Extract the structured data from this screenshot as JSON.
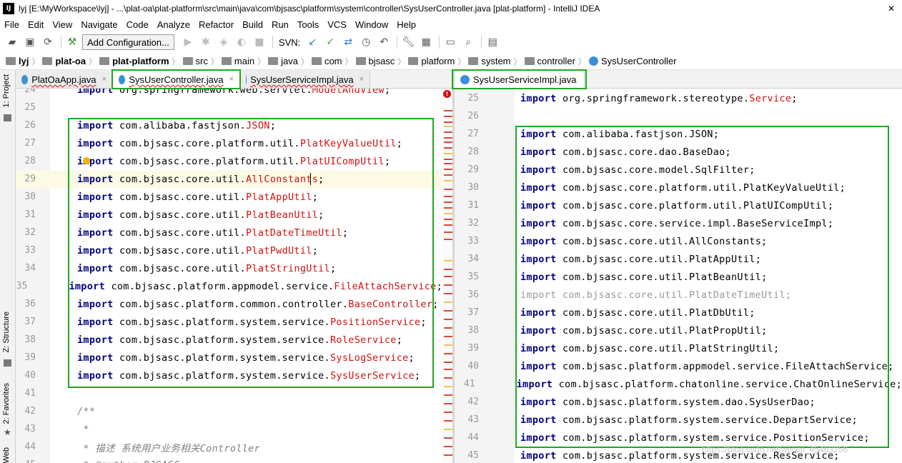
{
  "window": {
    "title": "lyj [E:\\MyWorkspace\\lyj] - ...\\plat-oa\\plat-platform\\src\\main\\java\\com\\bjsasc\\platform\\system\\controller\\SysUserController.java [plat-platform] - IntelliJ IDEA",
    "app_icon": "IJ",
    "close": "✕"
  },
  "menu": [
    "File",
    "Edit",
    "View",
    "Navigate",
    "Code",
    "Analyze",
    "Refactor",
    "Build",
    "Run",
    "Tools",
    "VCS",
    "Window",
    "Help"
  ],
  "toolbar": {
    "add_configuration": "Add Configuration...",
    "svn_label": "SVN:"
  },
  "breadcrumb": [
    "lyj",
    "plat-oa",
    "plat-platform",
    "src",
    "main",
    "java",
    "com",
    "bjsasc",
    "platform",
    "system",
    "controller",
    "SysUserController"
  ],
  "left_tabs": {
    "project": "1: Project",
    "structure": "Z: Structure",
    "favorites": "2: Favorites",
    "web": "Web"
  },
  "left_editor": {
    "tabs": [
      {
        "label": "PlatOaApp.java",
        "close": "×"
      },
      {
        "label": "SysUserController.java",
        "close": "×"
      },
      {
        "label": "SysUserServiceImpl.java",
        "close": "×"
      }
    ],
    "lines": [
      {
        "num": "24",
        "parts": [
          [
            "kw",
            "import"
          ],
          [
            "pk",
            " org.springframework.web.servlet."
          ],
          [
            "red",
            "ModelAndView"
          ],
          [
            "pk",
            ";"
          ]
        ]
      },
      {
        "num": "25",
        "parts": []
      },
      {
        "num": "26",
        "parts": [
          [
            "kw",
            "import"
          ],
          [
            "pk",
            " com.alibaba.fastjson."
          ],
          [
            "red",
            "JSON"
          ],
          [
            "pk",
            ";"
          ]
        ]
      },
      {
        "num": "27",
        "parts": [
          [
            "kw",
            "import"
          ],
          [
            "pk",
            " com.bjsasc.core.platform.util."
          ],
          [
            "red",
            "PlatKeyValueUtil"
          ],
          [
            "pk",
            ";"
          ]
        ]
      },
      {
        "num": "28",
        "parts": [
          [
            "kw",
            "import"
          ],
          [
            "pk",
            " com.bjsasc.core.platform.util."
          ],
          [
            "red",
            "PlatUICompUtil"
          ],
          [
            "pk",
            ";"
          ]
        ]
      },
      {
        "num": "29",
        "parts": [
          [
            "kw",
            "import"
          ],
          [
            "pk",
            " com.bjsasc.core.util."
          ],
          [
            "red",
            "AllConstants"
          ],
          [
            "pk",
            ";"
          ]
        ]
      },
      {
        "num": "30",
        "parts": [
          [
            "kw",
            "import"
          ],
          [
            "pk",
            " com.bjsasc.core.util."
          ],
          [
            "red",
            "PlatAppUtil"
          ],
          [
            "pk",
            ";"
          ]
        ]
      },
      {
        "num": "31",
        "parts": [
          [
            "kw",
            "import"
          ],
          [
            "pk",
            " com.bjsasc.core.util."
          ],
          [
            "red",
            "PlatBeanUtil"
          ],
          [
            "pk",
            ";"
          ]
        ]
      },
      {
        "num": "32",
        "parts": [
          [
            "kw",
            "import"
          ],
          [
            "pk",
            " com.bjsasc.core.util."
          ],
          [
            "red",
            "PlatDateTimeUtil"
          ],
          [
            "pk",
            ";"
          ]
        ]
      },
      {
        "num": "33",
        "parts": [
          [
            "kw",
            "import"
          ],
          [
            "pk",
            " com.bjsasc.core.util."
          ],
          [
            "red",
            "PlatPwdUtil"
          ],
          [
            "pk",
            ";"
          ]
        ]
      },
      {
        "num": "34",
        "parts": [
          [
            "kw",
            "import"
          ],
          [
            "pk",
            " com.bjsasc.core.util."
          ],
          [
            "red",
            "PlatStringUtil"
          ],
          [
            "pk",
            ";"
          ]
        ]
      },
      {
        "num": "35",
        "parts": [
          [
            "kw",
            "import"
          ],
          [
            "pk",
            " com.bjsasc.platform.appmodel.service."
          ],
          [
            "red",
            "FileAttachService"
          ],
          [
            "pk",
            ";"
          ]
        ]
      },
      {
        "num": "36",
        "parts": [
          [
            "kw",
            "import"
          ],
          [
            "pk",
            " com.bjsasc.platform.common.controller."
          ],
          [
            "red",
            "BaseController"
          ],
          [
            "pk",
            ";"
          ]
        ]
      },
      {
        "num": "37",
        "parts": [
          [
            "kw",
            "import"
          ],
          [
            "pk",
            " com.bjsasc.platform.system.service."
          ],
          [
            "red",
            "PositionService"
          ],
          [
            "pk",
            ";"
          ]
        ]
      },
      {
        "num": "38",
        "parts": [
          [
            "kw",
            "import"
          ],
          [
            "pk",
            " com.bjsasc.platform.system.service."
          ],
          [
            "red",
            "RoleService"
          ],
          [
            "pk",
            ";"
          ]
        ]
      },
      {
        "num": "39",
        "parts": [
          [
            "kw",
            "import"
          ],
          [
            "pk",
            " com.bjsasc.platform.system.service."
          ],
          [
            "red",
            "SysLogService"
          ],
          [
            "pk",
            ";"
          ]
        ]
      },
      {
        "num": "40",
        "parts": [
          [
            "kw",
            "import"
          ],
          [
            "pk",
            " com.bjsasc.platform.system.service."
          ],
          [
            "red",
            "SysUserService"
          ],
          [
            "pk",
            ";"
          ]
        ]
      },
      {
        "num": "41",
        "parts": []
      },
      {
        "num": "42",
        "parts": [
          [
            "cm",
            "/**"
          ]
        ]
      },
      {
        "num": "43",
        "parts": [
          [
            "cm",
            " *"
          ]
        ]
      },
      {
        "num": "44",
        "parts": [
          [
            "cm",
            " * 描述 系统用户业务相关Controller"
          ]
        ]
      },
      {
        "num": "45",
        "parts": [
          [
            "cm",
            " * @author BJSASC"
          ]
        ]
      }
    ]
  },
  "right_editor": {
    "tabs": [
      {
        "label": "SysUserServiceImpl.java"
      }
    ],
    "lines": [
      {
        "num": "25",
        "parts": [
          [
            "kw",
            "import"
          ],
          [
            "pk",
            " org.springframework.stereotype."
          ],
          [
            "red",
            "Service"
          ],
          [
            "pk",
            ";"
          ]
        ]
      },
      {
        "num": "26",
        "parts": []
      },
      {
        "num": "27",
        "parts": [
          [
            "kw",
            "import"
          ],
          [
            "pk",
            " com.alibaba.fastjson.JSON;"
          ]
        ]
      },
      {
        "num": "28",
        "parts": [
          [
            "kw",
            "import"
          ],
          [
            "pk",
            " com.bjsasc.core.dao.BaseDao;"
          ]
        ]
      },
      {
        "num": "29",
        "parts": [
          [
            "kw",
            "import"
          ],
          [
            "pk",
            " com.bjsasc.core.model.SqlFilter;"
          ]
        ]
      },
      {
        "num": "30",
        "parts": [
          [
            "kw",
            "import"
          ],
          [
            "pk",
            " com.bjsasc.core.platform.util.PlatKeyValueUtil;"
          ]
        ]
      },
      {
        "num": "31",
        "parts": [
          [
            "kw",
            "import"
          ],
          [
            "pk",
            " com.bjsasc.core.platform.util.PlatUICompUtil;"
          ]
        ]
      },
      {
        "num": "32",
        "parts": [
          [
            "kw",
            "import"
          ],
          [
            "pk",
            " com.bjsasc.core.service.impl.BaseServiceImpl;"
          ]
        ]
      },
      {
        "num": "33",
        "parts": [
          [
            "kw",
            "import"
          ],
          [
            "pk",
            " com.bjsasc.core.util.AllConstants;"
          ]
        ]
      },
      {
        "num": "34",
        "parts": [
          [
            "kw",
            "import"
          ],
          [
            "pk",
            " com.bjsasc.core.util.PlatAppUtil;"
          ]
        ]
      },
      {
        "num": "35",
        "parts": [
          [
            "kw",
            "import"
          ],
          [
            "pk",
            " com.bjsasc.core.util.PlatBeanUtil;"
          ]
        ]
      },
      {
        "num": "36",
        "parts": [
          [
            "grey",
            "import com.bjsasc.core.util.PlatDateTimeUtil;"
          ]
        ]
      },
      {
        "num": "37",
        "parts": [
          [
            "kw",
            "import"
          ],
          [
            "pk",
            " com.bjsasc.core.util.PlatDbUtil;"
          ]
        ]
      },
      {
        "num": "38",
        "parts": [
          [
            "kw",
            "import"
          ],
          [
            "pk",
            " com.bjsasc.core.util.PlatPropUtil;"
          ]
        ]
      },
      {
        "num": "39",
        "parts": [
          [
            "kw",
            "import"
          ],
          [
            "pk",
            " com.bjsasc.core.util.PlatStringUtil;"
          ]
        ]
      },
      {
        "num": "40",
        "parts": [
          [
            "kw",
            "import"
          ],
          [
            "pk",
            " com.bjsasc.platform.appmodel.service.FileAttachService;"
          ]
        ]
      },
      {
        "num": "41",
        "parts": [
          [
            "kw",
            "import"
          ],
          [
            "pk",
            " com.bjsasc.platform.chatonline.service.ChatOnlineService;"
          ]
        ]
      },
      {
        "num": "42",
        "parts": [
          [
            "kw",
            "import"
          ],
          [
            "pk",
            " com.bjsasc.platform.system.dao.SysUserDao;"
          ]
        ]
      },
      {
        "num": "43",
        "parts": [
          [
            "kw",
            "import"
          ],
          [
            "pk",
            " com.bjsasc.platform.system.service.DepartService;"
          ]
        ]
      },
      {
        "num": "44",
        "parts": [
          [
            "kw",
            "import"
          ],
          [
            "pk",
            " com.bjsasc.platform.system.service.PositionService;"
          ]
        ]
      },
      {
        "num": "45",
        "parts": [
          [
            "kw",
            "import"
          ],
          [
            "pk",
            " com.bjsasc.platform.system.service.ResService;"
          ]
        ]
      }
    ]
  },
  "watermark": "https://blog.csdn.net/weixin_45463256",
  "colors": {
    "highlight": "#1fa81f",
    "keyword": "#000080",
    "unresolved": "#d01010"
  }
}
